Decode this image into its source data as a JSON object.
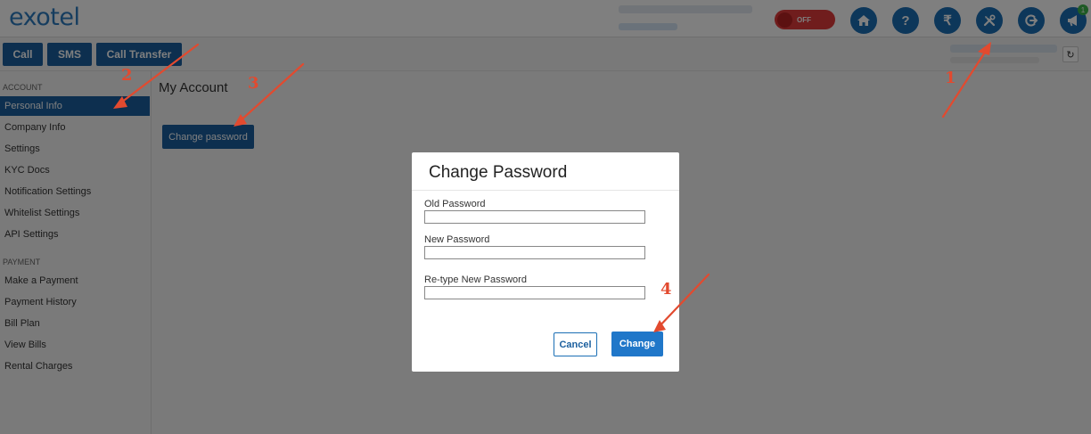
{
  "header": {
    "logo": "exotel",
    "logo_x": "x",
    "toggle_label": "OFF",
    "icons": [
      "home-icon",
      "help-icon",
      "rupee-icon",
      "tools-icon",
      "logout-icon",
      "megaphone-icon"
    ],
    "rupee_symbol": "₹",
    "help_symbol": "?",
    "notification_count": "1"
  },
  "actions": {
    "call": "Call",
    "sms": "SMS",
    "call_transfer": "Call Transfer"
  },
  "sidebar": {
    "account_header": "ACCOUNT",
    "account_items": [
      "Personal Info",
      "Company Info",
      "Settings",
      "KYC Docs",
      "Notification Settings",
      "Whitelist Settings",
      "API Settings"
    ],
    "payment_header": "PAYMENT",
    "payment_items": [
      "Make a Payment",
      "Payment History",
      "Bill Plan",
      "View Bills",
      "Rental Charges"
    ]
  },
  "main": {
    "title": "My Account",
    "change_password_button": "Change password"
  },
  "modal": {
    "title": "Change Password",
    "old_password_label": "Old Password",
    "new_password_label": "New Password",
    "retype_label": "Re-type New Password",
    "cancel_label": "Cancel",
    "change_label": "Change"
  },
  "annotations": {
    "step1": "1",
    "step2": "2",
    "step3": "3",
    "step4": "4",
    "arrow_color": "#e24a2f"
  },
  "colors": {
    "primary": "#1b5f9e",
    "toggle_off": "#e03a3a"
  }
}
